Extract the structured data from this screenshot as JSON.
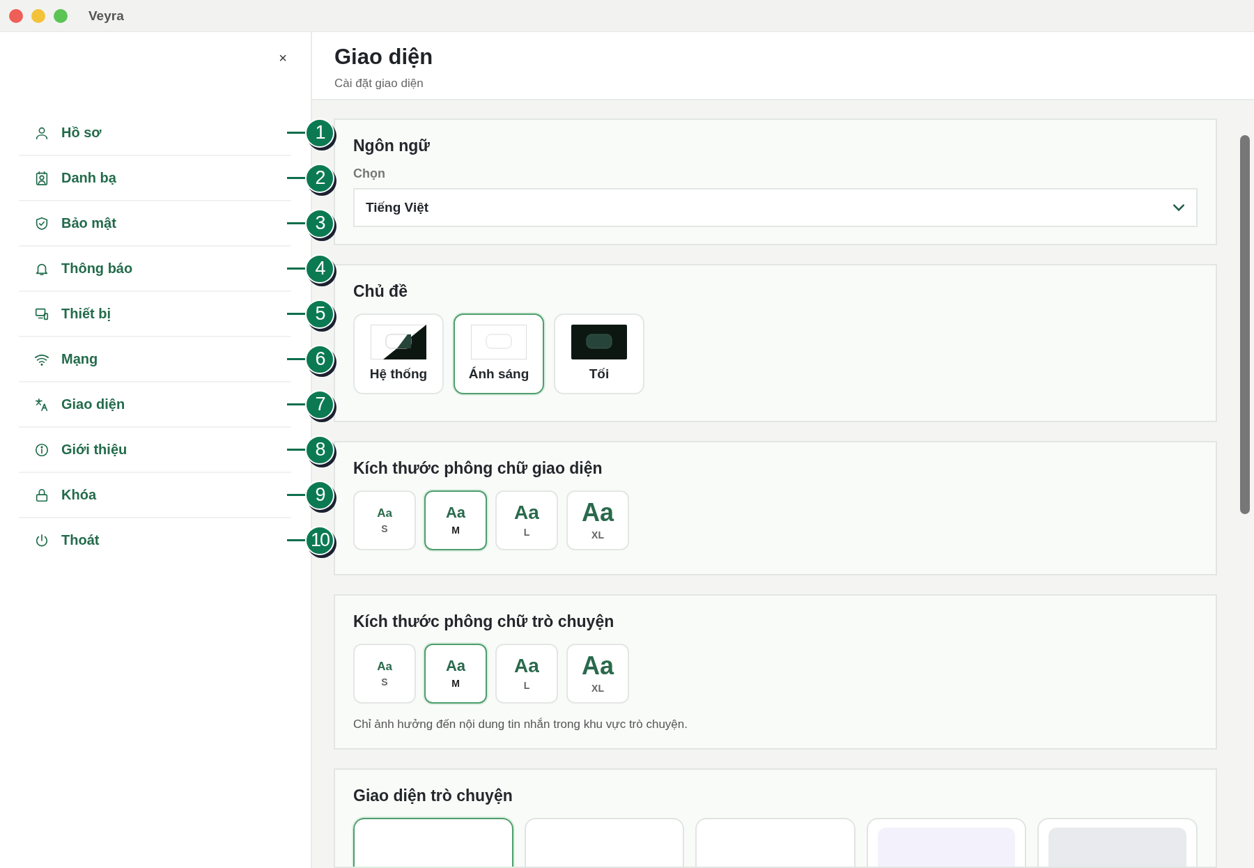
{
  "window": {
    "title": "Veyra"
  },
  "sidebar": {
    "close": "×",
    "items": [
      {
        "label": "Hồ sơ",
        "callout": "1"
      },
      {
        "label": "Danh bạ",
        "callout": "2"
      },
      {
        "label": "Bảo mật",
        "callout": "3"
      },
      {
        "label": "Thông báo",
        "callout": "4"
      },
      {
        "label": "Thiết bị",
        "callout": "5"
      },
      {
        "label": "Mạng",
        "callout": "6"
      },
      {
        "label": "Giao diện",
        "callout": "7"
      },
      {
        "label": "Giới thiệu",
        "callout": "8"
      },
      {
        "label": "Khóa",
        "callout": "9"
      },
      {
        "label": "Thoát",
        "callout": "10"
      }
    ]
  },
  "header": {
    "title": "Giao diện",
    "subtitle": "Cài đặt giao diện"
  },
  "language": {
    "heading": "Ngôn ngữ",
    "label": "Chọn",
    "value": "Tiếng Việt"
  },
  "theme": {
    "heading": "Chủ đề",
    "options": [
      {
        "label": "Hệ thống",
        "kind": "system",
        "selected": false
      },
      {
        "label": "Ánh sáng",
        "kind": "light",
        "selected": true
      },
      {
        "label": "Tối",
        "kind": "dark",
        "selected": false
      }
    ]
  },
  "ui_font_size": {
    "heading": "Kích thước phông chữ giao diện",
    "options": [
      {
        "sample": "Aa",
        "size": "S",
        "selected": false
      },
      {
        "sample": "Aa",
        "size": "M",
        "selected": true
      },
      {
        "sample": "Aa",
        "size": "L",
        "selected": false
      },
      {
        "sample": "Aa",
        "size": "XL",
        "selected": false
      }
    ]
  },
  "chat_font_size": {
    "heading": "Kích thước phông chữ trò chuyện",
    "options": [
      {
        "sample": "Aa",
        "size": "S",
        "selected": false
      },
      {
        "sample": "Aa",
        "size": "M",
        "selected": true
      },
      {
        "sample": "Aa",
        "size": "L",
        "selected": false
      },
      {
        "sample": "Aa",
        "size": "XL",
        "selected": false
      }
    ],
    "note": "Chỉ ảnh hưởng đến nội dung tin nhắn trong khu vực trò chuyện."
  },
  "chat_appearance": {
    "heading": "Giao diện trò chuyện",
    "options": [
      {
        "kind": "plain",
        "selected": true
      },
      {
        "kind": "plain",
        "selected": false
      },
      {
        "kind": "plain",
        "selected": false
      },
      {
        "kind": "swatch",
        "color": "#f3f2fc",
        "selected": false
      },
      {
        "kind": "swatch",
        "color": "#e8eaee",
        "selected": false
      }
    ]
  }
}
